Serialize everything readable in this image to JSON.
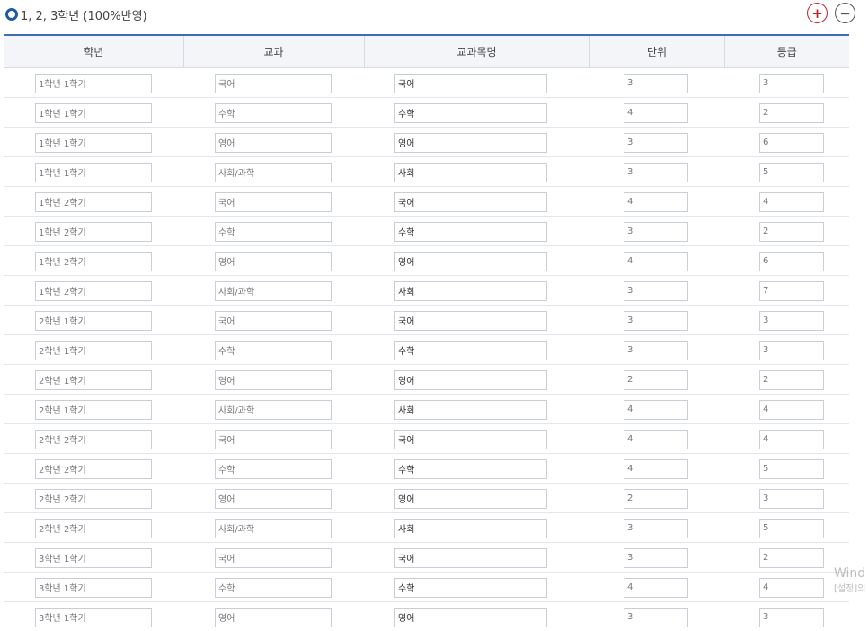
{
  "section": {
    "title": "1, 2, 3학년 (100%반영)",
    "add_label": "+",
    "remove_label": "−"
  },
  "table": {
    "headers": [
      "학년",
      "교과",
      "교과목명",
      "단위",
      "등급"
    ],
    "rows": [
      [
        "1학년 1학기",
        "국어",
        "국어",
        "3",
        "3"
      ],
      [
        "1학년 1학기",
        "수학",
        "수학",
        "4",
        "2"
      ],
      [
        "1학년 1학기",
        "영어",
        "영어",
        "3",
        "6"
      ],
      [
        "1학년 1학기",
        "사회/과학",
        "사회",
        "3",
        "5"
      ],
      [
        "1학년 2학기",
        "국어",
        "국어",
        "4",
        "4"
      ],
      [
        "1학년 2학기",
        "수학",
        "수학",
        "3",
        "2"
      ],
      [
        "1학년 2학기",
        "영어",
        "영어",
        "4",
        "6"
      ],
      [
        "1학년 2학기",
        "사회/과학",
        "사회",
        "3",
        "7"
      ],
      [
        "2학년 1학기",
        "국어",
        "국어",
        "3",
        "3"
      ],
      [
        "2학년 1학기",
        "수학",
        "수학",
        "3",
        "3"
      ],
      [
        "2학년 1학기",
        "영어",
        "영어",
        "2",
        "2"
      ],
      [
        "2학년 1학기",
        "사회/과학",
        "사회",
        "4",
        "4"
      ],
      [
        "2학년 2학기",
        "국어",
        "국어",
        "4",
        "4"
      ],
      [
        "2학년 2학기",
        "수학",
        "수학",
        "4",
        "5"
      ],
      [
        "2학년 2학기",
        "영어",
        "영어",
        "2",
        "3"
      ],
      [
        "2학년 2학기",
        "사회/과학",
        "사회",
        "3",
        "5"
      ],
      [
        "3학년 1학기",
        "국어",
        "국어",
        "3",
        "2"
      ],
      [
        "3학년 1학기",
        "수학",
        "수학",
        "4",
        "4"
      ],
      [
        "3학년 1학기",
        "영어",
        "영어",
        "3",
        "3"
      ]
    ]
  },
  "watermark": {
    "line1": "Wind",
    "line2": "[설정]의"
  },
  "colors": {
    "accent": "#1e5aa8",
    "add_button": "#c0242a",
    "header_top_border": "#3e6fb2"
  }
}
